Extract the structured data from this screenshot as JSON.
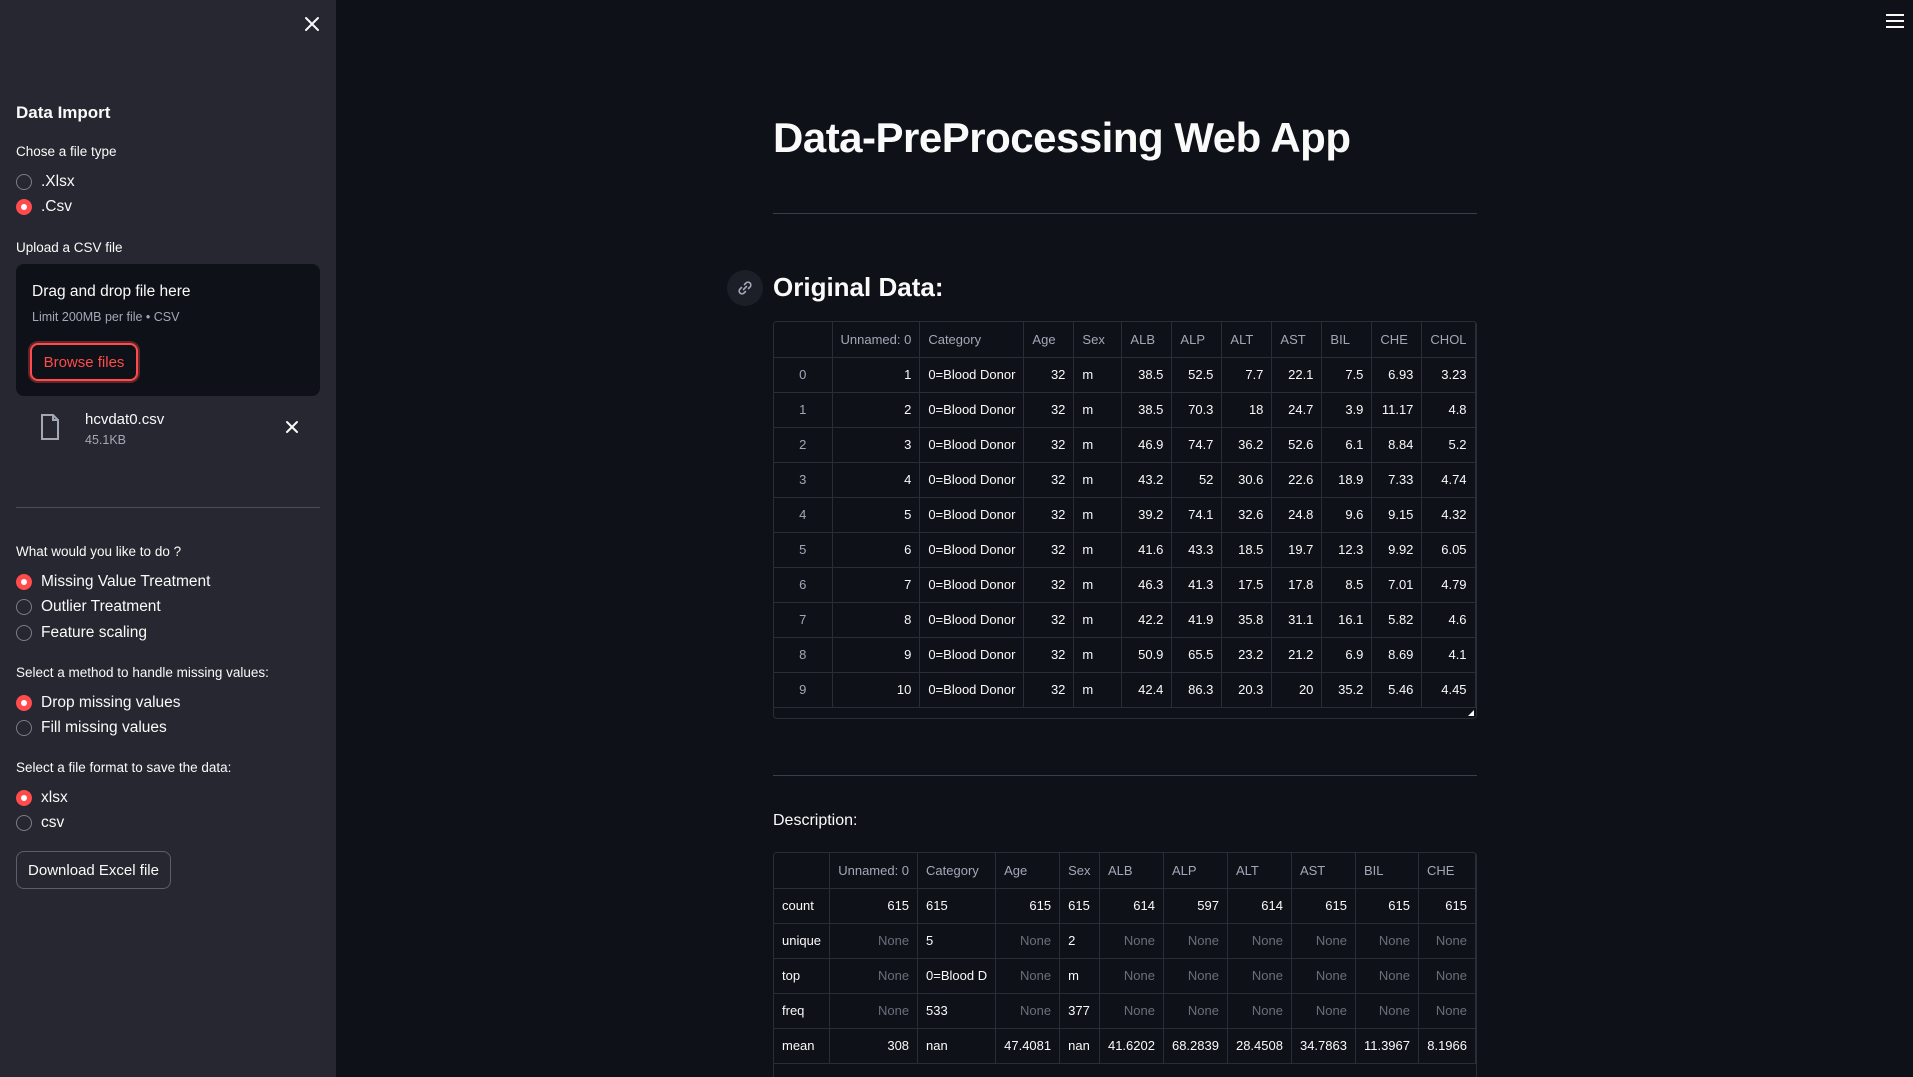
{
  "sidebar": {
    "section_title": "Data Import",
    "file_type_label": "Chose a file type",
    "file_types": [
      ".Xlsx",
      ".Csv"
    ],
    "upload_label": "Upload a CSV file",
    "uploader": {
      "title": "Drag and drop file here",
      "limit": "Limit 200MB per file • CSV",
      "browse_label": "Browse files"
    },
    "file": {
      "name": "hcvdat0.csv",
      "size": "45.1KB"
    },
    "action_label": "What would you like to do ?",
    "actions": [
      "Missing Value Treatment",
      "Outlier Treatment",
      "Feature scaling"
    ],
    "method_label": "Select a method to handle missing values:",
    "methods": [
      "Drop missing values",
      "Fill missing values"
    ],
    "format_label": "Select a file format to save the data:",
    "formats": [
      "xlsx",
      "csv"
    ],
    "download_label": "Download Excel file"
  },
  "main": {
    "title": "Data-PreProcessing Web App",
    "original_heading": "Original Data:",
    "description_label": "Description:"
  },
  "original_table": {
    "columns": [
      "",
      "Unnamed: 0",
      "Category",
      "Age",
      "Sex",
      "ALB",
      "ALP",
      "ALT",
      "AST",
      "BIL",
      "CHE",
      "CHOL"
    ],
    "rows": [
      [
        "0",
        "1",
        "0=Blood Donor",
        "32",
        "m",
        "38.5",
        "52.5",
        "7.7",
        "22.1",
        "7.5",
        "6.93",
        "3.23"
      ],
      [
        "1",
        "2",
        "0=Blood Donor",
        "32",
        "m",
        "38.5",
        "70.3",
        "18",
        "24.7",
        "3.9",
        "11.17",
        "4.8"
      ],
      [
        "2",
        "3",
        "0=Blood Donor",
        "32",
        "m",
        "46.9",
        "74.7",
        "36.2",
        "52.6",
        "6.1",
        "8.84",
        "5.2"
      ],
      [
        "3",
        "4",
        "0=Blood Donor",
        "32",
        "m",
        "43.2",
        "52",
        "30.6",
        "22.6",
        "18.9",
        "7.33",
        "4.74"
      ],
      [
        "4",
        "5",
        "0=Blood Donor",
        "32",
        "m",
        "39.2",
        "74.1",
        "32.6",
        "24.8",
        "9.6",
        "9.15",
        "4.32"
      ],
      [
        "5",
        "6",
        "0=Blood Donor",
        "32",
        "m",
        "41.6",
        "43.3",
        "18.5",
        "19.7",
        "12.3",
        "9.92",
        "6.05"
      ],
      [
        "6",
        "7",
        "0=Blood Donor",
        "32",
        "m",
        "46.3",
        "41.3",
        "17.5",
        "17.8",
        "8.5",
        "7.01",
        "4.79"
      ],
      [
        "7",
        "8",
        "0=Blood Donor",
        "32",
        "m",
        "42.2",
        "41.9",
        "35.8",
        "31.1",
        "16.1",
        "5.82",
        "4.6"
      ],
      [
        "8",
        "9",
        "0=Blood Donor",
        "32",
        "m",
        "50.9",
        "65.5",
        "23.2",
        "21.2",
        "6.9",
        "8.69",
        "4.1"
      ],
      [
        "9",
        "10",
        "0=Blood Donor",
        "32",
        "m",
        "42.4",
        "86.3",
        "20.3",
        "20",
        "35.2",
        "5.46",
        "4.45"
      ]
    ]
  },
  "description_table": {
    "columns": [
      "",
      "Unnamed: 0",
      "Category",
      "Age",
      "Sex",
      "ALB",
      "ALP",
      "ALT",
      "AST",
      "BIL",
      "CHE"
    ],
    "rows": [
      [
        "count",
        "615",
        "615",
        "615",
        "615",
        "614",
        "597",
        "614",
        "615",
        "615",
        "615"
      ],
      [
        "unique",
        "None",
        "5",
        "None",
        "2",
        "None",
        "None",
        "None",
        "None",
        "None",
        "None"
      ],
      [
        "top",
        "None",
        "0=Blood D",
        "None",
        "m",
        "None",
        "None",
        "None",
        "None",
        "None",
        "None"
      ],
      [
        "freq",
        "None",
        "533",
        "None",
        "377",
        "None",
        "None",
        "None",
        "None",
        "None",
        "None"
      ],
      [
        "mean",
        "308",
        "nan",
        "47.4081",
        "nan",
        "41.6202",
        "68.2839",
        "28.4508",
        "34.7863",
        "11.3967",
        "8.1966"
      ]
    ]
  },
  "colors": {
    "accent": "#ff4b4b",
    "background": "#0e1117",
    "sidebar": "#262730"
  }
}
